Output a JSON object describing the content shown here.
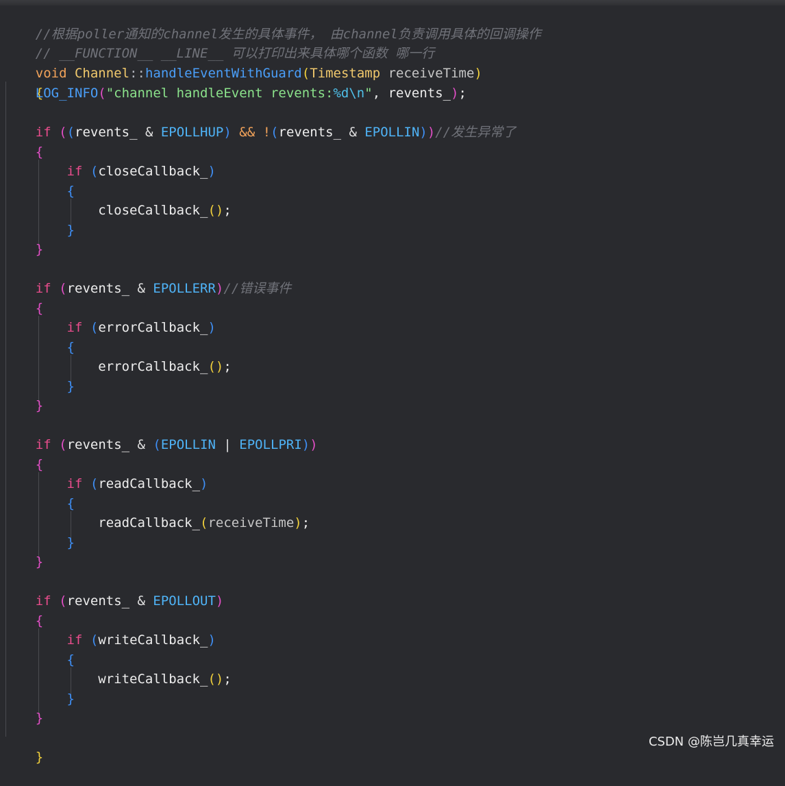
{
  "code": {
    "line_1_comment": "//根据poller通知的channel发生的具体事件， 由channel负责调用具体的回调操作",
    "line_2_comment": "// __FUNCTION__ __LINE__ 可以打印出来具体哪个函数 哪一行",
    "line_3": {
      "return_type": "void",
      "class_name": "Channel",
      "scope_op": "::",
      "function_name": "handleEventWithGuard",
      "paren_open": "(",
      "param_type": "Timestamp",
      "param_name": "receiveTime",
      "paren_close": ")"
    },
    "brace_open": "{",
    "brace_close": "}",
    "log_line": {
      "macro": "LOG_INFO",
      "paren_open": "(",
      "string_start": "\"channel handleEvent revents:",
      "format_spec": "%d\\n",
      "string_end": "\"",
      "args": ", revents_",
      "paren_close": ")",
      "semicolon": ";"
    },
    "if_hup": {
      "keyword": "if",
      "outer_open": "(",
      "inner_open": "(",
      "var": "revents_",
      "amp": " & ",
      "flag_a": "EPOLLHUP",
      "inner_close": ")",
      "logic": " && ",
      "not": "!",
      "inner_open_2": "(",
      "var_2": "revents_",
      "amp_2": " & ",
      "flag_b": "EPOLLIN",
      "inner_close_2": ")",
      "outer_close": ")",
      "comment": "//发生异常了"
    },
    "if_close_cb": {
      "keyword": "if",
      "paren_open": "(",
      "name": "closeCallback_",
      "paren_close": ")",
      "call": "closeCallback_",
      "call_parens": "()",
      "semicolon": ";"
    },
    "if_err": {
      "keyword": "if",
      "paren_open": "(",
      "var": "revents_",
      "amp": " & ",
      "flag": "EPOLLERR",
      "paren_close": ")",
      "comment": "//错误事件"
    },
    "if_error_cb": {
      "keyword": "if",
      "paren_open": "(",
      "name": "errorCallback_",
      "paren_close": ")",
      "call": "errorCallback_",
      "call_parens": "()",
      "semicolon": ";"
    },
    "if_in": {
      "keyword": "if",
      "paren_open": "(",
      "var": "revents_",
      "amp": " & ",
      "inner_open": "(",
      "flag_a": "EPOLLIN",
      "pipe": " | ",
      "flag_b": "EPOLLPRI",
      "inner_close": ")",
      "paren_close": ")"
    },
    "if_read_cb": {
      "keyword": "if",
      "paren_open": "(",
      "name": "readCallback_",
      "paren_close": ")",
      "call": "readCallback_",
      "call_paren_open": "(",
      "call_arg": "receiveTime",
      "call_paren_close": ")",
      "semicolon": ";"
    },
    "if_out": {
      "keyword": "if",
      "paren_open": "(",
      "var": "revents_",
      "amp": " & ",
      "flag": "EPOLLOUT",
      "paren_close": ")"
    },
    "if_write_cb": {
      "keyword": "if",
      "paren_open": "(",
      "name": "writeCallback_",
      "paren_close": ")",
      "call": "writeCallback_",
      "call_parens": "()",
      "semicolon": ";"
    }
  },
  "watermark": "CSDN @陈岂几真幸运",
  "colors": {
    "background": "#292a2e",
    "comment": "#707279",
    "keyword": "#ea4d8d",
    "type": "#f3a35a",
    "class": "#f0c86c",
    "function": "#4a9ef8",
    "string": "#8be28b",
    "constant": "#4fb4f8",
    "bracket_level_1": "#f2d13c",
    "bracket_level_2": "#e24fc6",
    "bracket_level_3": "#3f8ff5"
  }
}
